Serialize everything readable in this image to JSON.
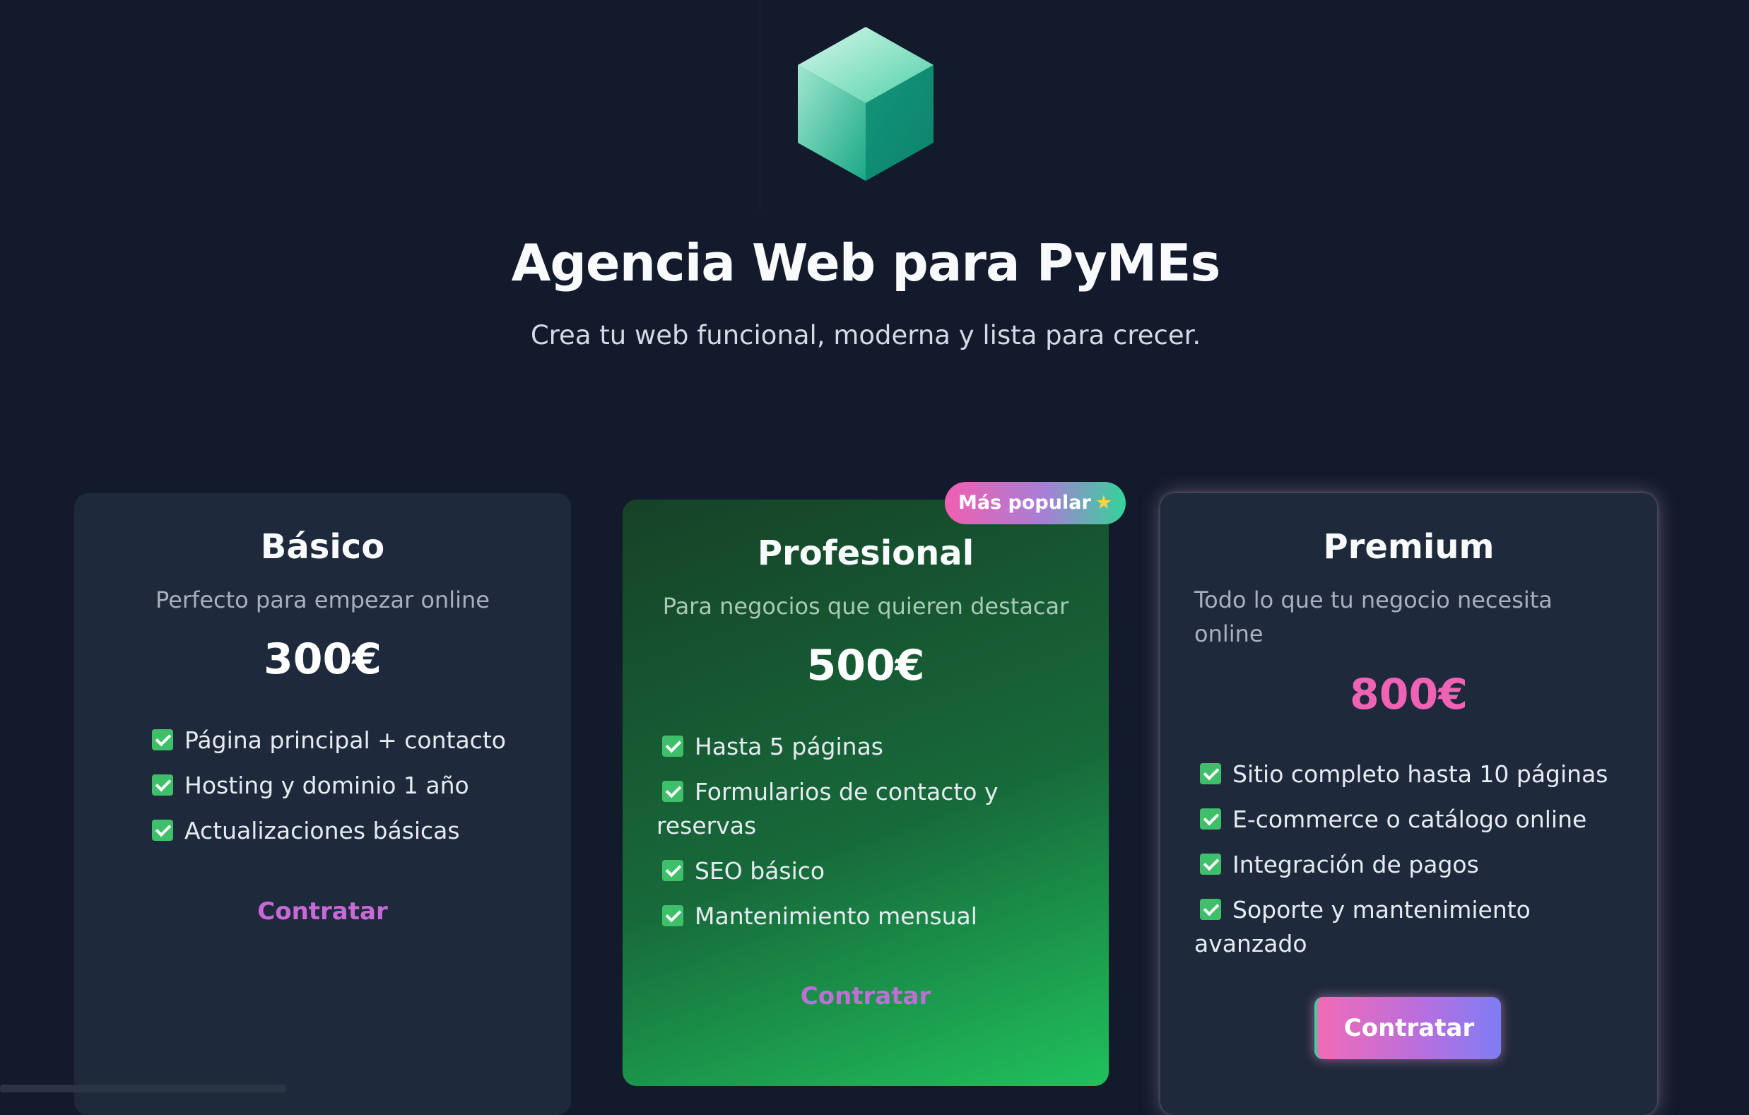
{
  "header": {
    "logo": "cube-logo",
    "title": "Agencia Web para PyMEs",
    "subtitle": "Crea tu web funcional, moderna y lista para crecer."
  },
  "plans": [
    {
      "name": "Básico",
      "description": "Perfecto para empezar online",
      "price": "300€",
      "features": [
        "Página principal + contacto",
        "Hosting y dominio 1 año",
        "Actualizaciones básicas"
      ],
      "cta_label": "Contratar"
    },
    {
      "name": "Profesional",
      "badge": "Más popular",
      "badge_icon": "star-icon",
      "description": "Para negocios que quieren destacar",
      "price": "500€",
      "features": [
        "Hasta 5 páginas",
        "Formularios de contacto y reservas",
        "SEO básico",
        "Mantenimiento mensual"
      ],
      "cta_label": "Contratar"
    },
    {
      "name": "Premium",
      "description": "Todo lo que tu negocio necesita online",
      "price": "800€",
      "features": [
        "Sitio completo hasta 10 páginas",
        "E-commerce o catálogo online",
        "Integración de pagos",
        "Soporte y mantenimiento avanzado"
      ],
      "cta_label": "Contratar"
    }
  ],
  "colors": {
    "background": "#121a2b",
    "card": "#1e293b",
    "accent_pink": "#f062b4",
    "accent_purple": "#c869d8",
    "accent_green": "#22c55e",
    "check_green": "#3fbf6a"
  }
}
